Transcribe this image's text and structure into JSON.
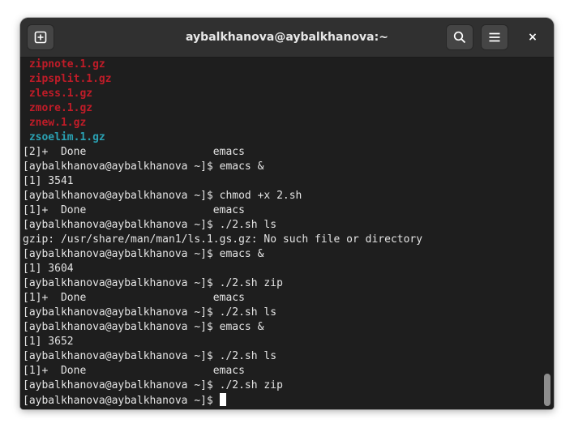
{
  "window": {
    "title": "aybalkhanova@aybalkhanova:~",
    "close_glyph": "×"
  },
  "terminal": {
    "lines": [
      {
        "text": " zipnote.1.gz",
        "style": "red"
      },
      {
        "text": " zipsplit.1.gz",
        "style": "red"
      },
      {
        "text": " zless.1.gz",
        "style": "red"
      },
      {
        "text": " zmore.1.gz",
        "style": "red"
      },
      {
        "text": " znew.1.gz",
        "style": "red"
      },
      {
        "text": " zsoelim.1.gz",
        "style": "cyan"
      },
      {
        "text": "[2]+  Done                    emacs",
        "style": "plain"
      },
      {
        "text": "[aybalkhanova@aybalkhanova ~]$ emacs &",
        "style": "plain"
      },
      {
        "text": "[1] 3541",
        "style": "plain"
      },
      {
        "text": "[aybalkhanova@aybalkhanova ~]$ chmod +x 2.sh",
        "style": "plain"
      },
      {
        "text": "[1]+  Done                    emacs",
        "style": "plain"
      },
      {
        "text": "[aybalkhanova@aybalkhanova ~]$ ./2.sh ls",
        "style": "plain"
      },
      {
        "text": "gzip: /usr/share/man/man1/ls.1.gs.gz: No such file or directory",
        "style": "plain"
      },
      {
        "text": "[aybalkhanova@aybalkhanova ~]$ emacs &",
        "style": "plain"
      },
      {
        "text": "[1] 3604",
        "style": "plain"
      },
      {
        "text": "[aybalkhanova@aybalkhanova ~]$ ./2.sh zip",
        "style": "plain"
      },
      {
        "text": "[1]+  Done                    emacs",
        "style": "plain"
      },
      {
        "text": "[aybalkhanova@aybalkhanova ~]$ ./2.sh ls",
        "style": "plain"
      },
      {
        "text": "[aybalkhanova@aybalkhanova ~]$ emacs &",
        "style": "plain"
      },
      {
        "text": "[1] 3652",
        "style": "plain"
      },
      {
        "text": "[aybalkhanova@aybalkhanova ~]$ ./2.sh ls",
        "style": "plain"
      },
      {
        "text": "[1]+  Done                    emacs",
        "style": "plain"
      },
      {
        "text": "[aybalkhanova@aybalkhanova ~]$ ./2.sh zip",
        "style": "plain"
      }
    ],
    "prompt": "[aybalkhanova@aybalkhanova ~]$ "
  },
  "icons": {
    "new_tab": "new-tab-icon",
    "search": "search-icon",
    "menu": "hamburger-menu-icon",
    "close": "close-icon"
  },
  "colors": {
    "background": "#1e1e1e",
    "headerbar": "#303030",
    "foreground": "#e4e4e4",
    "archive_red": "#c01c28",
    "link_cyan": "#2aa1b3"
  }
}
